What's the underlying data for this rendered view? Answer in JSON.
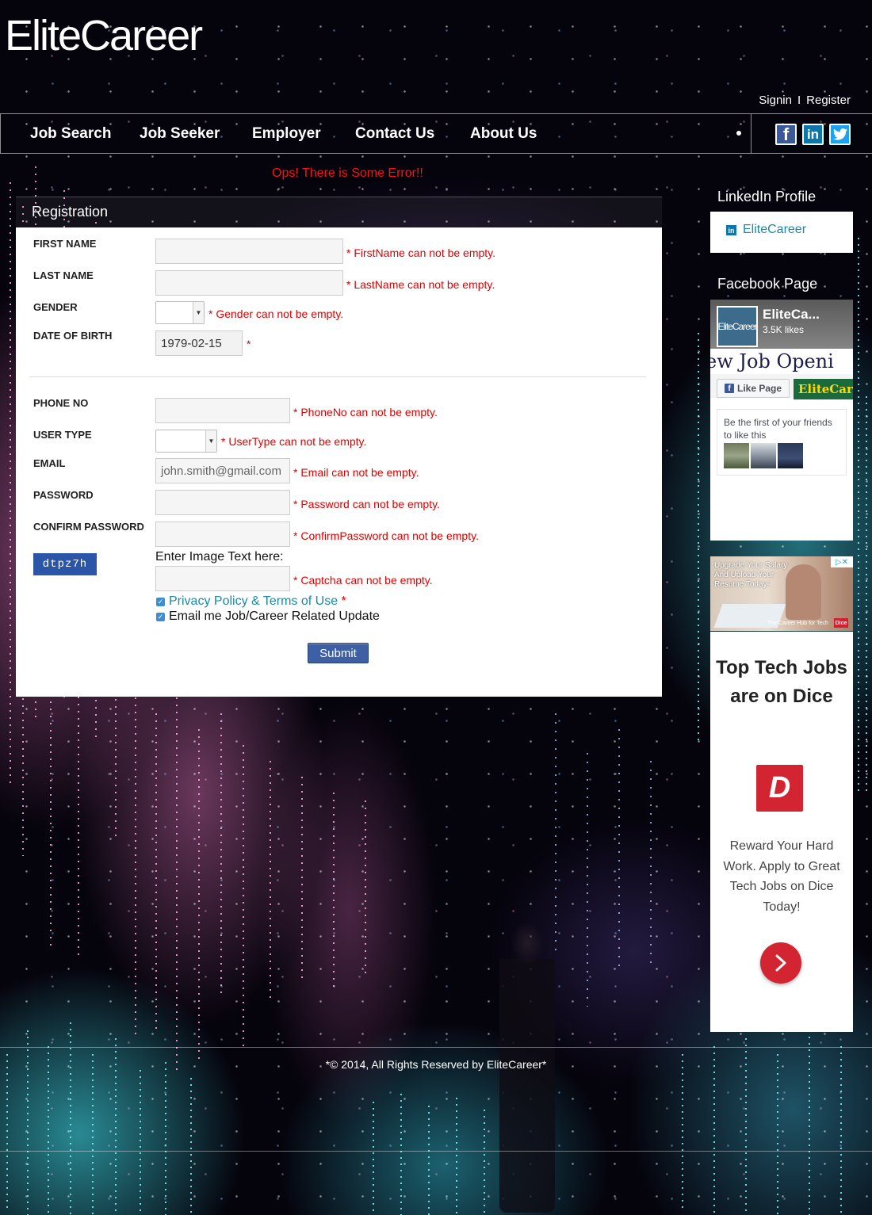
{
  "brand": {
    "logo_text": "EliteCareer"
  },
  "userlinks": {
    "signin": "Signin",
    "separator": "I",
    "register": "Register"
  },
  "nav": {
    "items": [
      "Job Search",
      "Job Seeker",
      "Employer",
      "Contact Us",
      "About Us"
    ],
    "social": {
      "facebook": "f",
      "linkedin": "in",
      "twitter": "t"
    }
  },
  "error_banner": "Ops! There is Some Error!!",
  "registration": {
    "title": "Registration",
    "fields": {
      "first_name": {
        "label": "FIRST NAME",
        "value": "",
        "error": "* FirstName can not be empty."
      },
      "last_name": {
        "label": "LAST NAME",
        "value": "",
        "error": "* LastName can not be empty."
      },
      "gender": {
        "label": "GENDER",
        "value": "",
        "error": "* Gender can not be empty."
      },
      "dob": {
        "label": "DATE OF BIRTH",
        "value": "1979-02-15",
        "error": "*"
      },
      "phone": {
        "label": "PHONE NO",
        "value": "",
        "error": "* PhoneNo can not be empty."
      },
      "user_type": {
        "label": "USER TYPE",
        "value": "",
        "error": "* UserType can not be empty."
      },
      "email": {
        "label": "EMAIL",
        "placeholder": "john.smith@gmail.com",
        "error": "* Email can not be empty."
      },
      "password": {
        "label": "PASSWORD",
        "value": "",
        "error": "* Password can not be empty."
      },
      "confirm_password": {
        "label": "CONFIRM PASSWORD",
        "value": "",
        "error": "* ConfirmPassword can not be empty."
      },
      "captcha": {
        "image_text": "dtpz7h",
        "prompt": "Enter Image Text here:",
        "value": "",
        "error": "* Captcha can not be empty."
      }
    },
    "checkboxes": {
      "privacy": {
        "label": "Privacy Policy & Terms of Use",
        "required_mark": "*",
        "checked": true
      },
      "updates": {
        "label": "Email me Job/Career Related Update",
        "checked": true
      }
    },
    "submit_label": "Submit"
  },
  "sidebar": {
    "linkedin": {
      "title": "LinkedIn Profile",
      "icon": "linkedin-icon",
      "link_text": "EliteCareer"
    },
    "facebook": {
      "title": "Facebook Page",
      "page_name": "EliteCa...",
      "thumb_text": "EliteCareer",
      "likes": "3.5K likes",
      "banner_text": "ew Job Openi",
      "like_button": "Like Page",
      "badge_text": "EliteCar",
      "friends_text": "Be the first of your friends to like this"
    },
    "ad_small": {
      "text": "Upgrade Your Salary And Upload Your Resume Today!",
      "footer": "The Career Hub for Tech",
      "brand": "Dice"
    },
    "ad_dice": {
      "title": "Top Tech Jobs are on Dice",
      "logo": "D",
      "text": "Reward Your Hard Work. Apply to Great Tech Jobs on Dice Today!",
      "button_icon": "chevron-right-icon"
    }
  },
  "footer": {
    "text": "*© 2014, All Rights Reserved by EliteCareer*"
  },
  "colors": {
    "error": "#e00000",
    "link": "#1a8aa8",
    "submit": "#3e5fa3",
    "dice_red": "#d32431"
  }
}
